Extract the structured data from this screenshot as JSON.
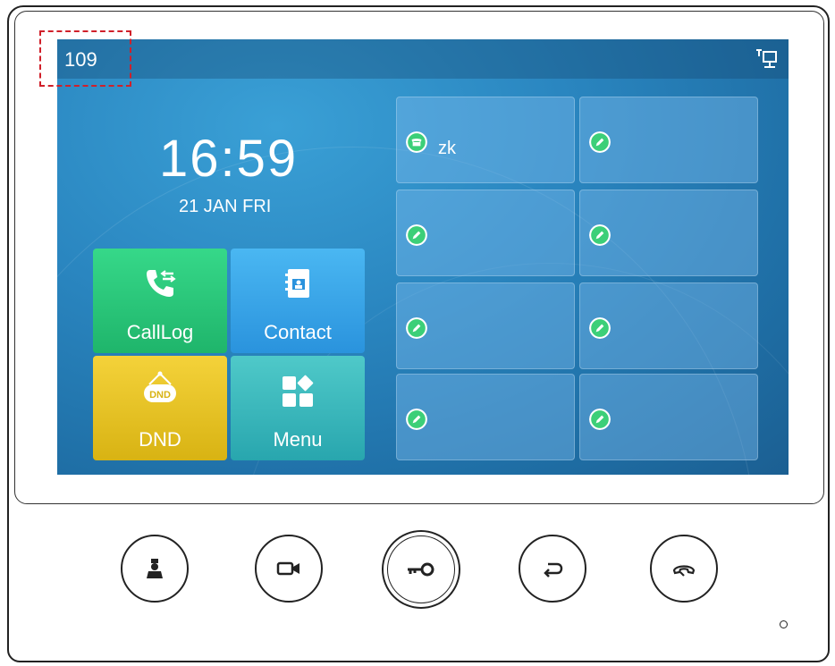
{
  "statusbar": {
    "account": "109",
    "network_icon": "network-icon"
  },
  "home": {
    "time": "16:59",
    "date": "21 JAN FRI"
  },
  "tiles": [
    {
      "label": "CallLog",
      "icon": "call-log-icon",
      "color": "#2cc77a"
    },
    {
      "label": "Contact",
      "icon": "contact-book-icon",
      "color": "#3aa6e8"
    },
    {
      "label": "DND",
      "icon": "dnd-icon",
      "color": "#e6c41f"
    },
    {
      "label": "Menu",
      "icon": "menu-grid-icon",
      "color": "#33b6bd"
    }
  ],
  "dss_keys": [
    {
      "label": "zk",
      "icon": "line-phone-icon"
    },
    {
      "label": "",
      "icon": "edit-icon"
    },
    {
      "label": "",
      "icon": "edit-icon"
    },
    {
      "label": "",
      "icon": "edit-icon"
    },
    {
      "label": "",
      "icon": "edit-icon"
    },
    {
      "label": "",
      "icon": "edit-icon"
    },
    {
      "label": "",
      "icon": "edit-icon"
    },
    {
      "label": "",
      "icon": "edit-icon"
    }
  ],
  "hardware_buttons": [
    {
      "icon": "monitor-person-icon"
    },
    {
      "icon": "camera-icon"
    },
    {
      "icon": "key-icon"
    },
    {
      "icon": "back-icon"
    },
    {
      "icon": "hang-up-icon"
    }
  ],
  "colors": {
    "highlight": "#d0202a",
    "key_badge": "#3ccf78"
  }
}
